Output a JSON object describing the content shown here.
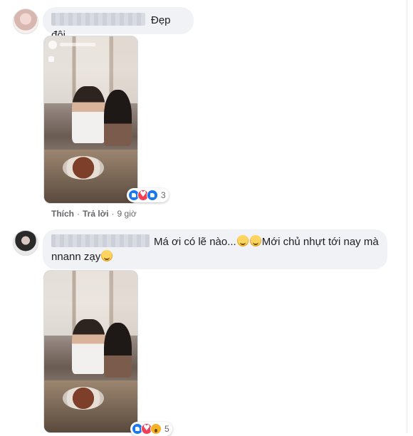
{
  "comments": [
    {
      "text": "Đẹp đôi",
      "reaction_count": "3",
      "actions": {
        "like": "Thích",
        "reply": "Trả lời",
        "time": "9 giờ"
      }
    },
    {
      "text_part1": "Má ơi có lẽ nào...",
      "text_part2": "Mới chủ nhựt tới nay mà",
      "text_part3": "nnann zạy",
      "reaction_count": "5"
    }
  ],
  "icons": {
    "avatar": "avatar-icon",
    "reaction_like": "like-reaction-icon",
    "reaction_love": "love-reaction-icon",
    "reaction_wow": "wow-reaction-icon",
    "emoji": "crying-emoji-icon"
  }
}
